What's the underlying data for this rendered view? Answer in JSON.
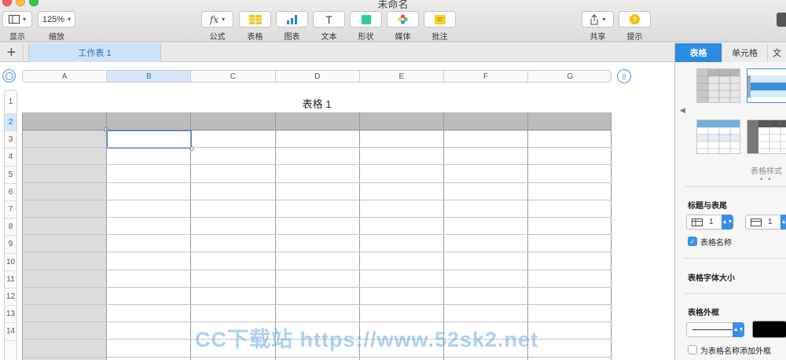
{
  "window": {
    "title": "未命名"
  },
  "toolbar": {
    "items": [
      {
        "label": "显示",
        "icon": "sidebar-icon"
      },
      {
        "label": "缩放",
        "value": "125%"
      },
      {
        "label": "公式",
        "icon": "fx-icon",
        "glyph": "fx"
      },
      {
        "label": "表格",
        "icon": "table-icon"
      },
      {
        "label": "图表",
        "icon": "chart-icon"
      },
      {
        "label": "文本",
        "icon": "text-icon",
        "glyph": "T"
      },
      {
        "label": "形状",
        "icon": "shape-icon"
      },
      {
        "label": "媒体",
        "icon": "media-icon"
      },
      {
        "label": "批注",
        "icon": "comment-icon"
      },
      {
        "label": "共享",
        "icon": "share-icon"
      },
      {
        "label": "提示",
        "icon": "tips-icon",
        "glyph": "?"
      }
    ]
  },
  "sheets": {
    "add_glyph": "+",
    "tabs": [
      "工作表 1"
    ]
  },
  "table": {
    "title": "表格 1",
    "columns": [
      "A",
      "B",
      "C",
      "D",
      "E",
      "F",
      "G"
    ],
    "rows": [
      "1",
      "2",
      "3",
      "4",
      "5",
      "6",
      "7",
      "8",
      "9",
      "10",
      "11",
      "12",
      "13",
      "14"
    ],
    "active_column": "B",
    "active_row": "2"
  },
  "inspector": {
    "tabs": [
      "表格",
      "单元格",
      "文"
    ],
    "styles_label": "表格样式",
    "page_dots": "• •",
    "headers_section": "标题与表尾",
    "header_rows_value": "1",
    "header_cols_value": "1",
    "table_name_checkbox": "表格名称",
    "font_size_section": "表格字体大小",
    "border_section": "表格外框",
    "outline_checkbox": "为表格名称添加外框",
    "border_color": "#000000",
    "accent_color": "#2b8be0"
  },
  "watermark": "CC下载站 https://www.52sk2.net"
}
